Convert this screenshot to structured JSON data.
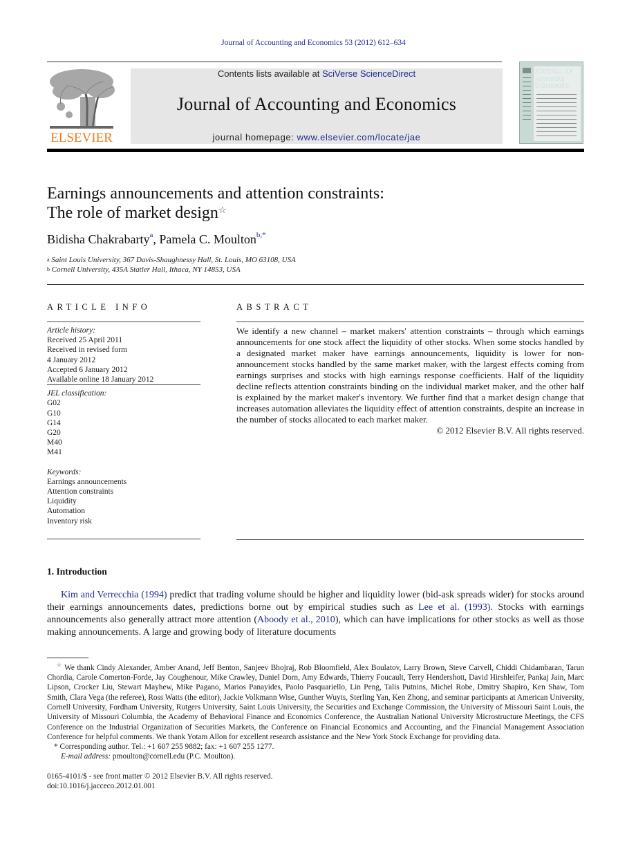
{
  "running_head": "Journal of Accounting and Economics 53 (2012) 612–634",
  "masthead": {
    "publisher_wordmark": "ELSEVIER",
    "contents_prefix": "Contents lists available at ",
    "contents_link": "SciVerse ScienceDirect",
    "journal_title": "Journal of Accounting and Economics",
    "homepage_prefix": "journal homepage: ",
    "homepage_link": "www.elsevier.com/locate/jae",
    "cover_title_lines": [
      "JOURNAL OF",
      "Accounting",
      "& Economics"
    ]
  },
  "article": {
    "title_line1": "Earnings announcements and attention constraints:",
    "title_line2": "The role of market design",
    "title_footnote_mark": "☆",
    "authors": [
      {
        "name": "Bidisha Chakrabarty",
        "marks": "a"
      },
      {
        "name": "Pamela C. Moulton",
        "marks": "b,*"
      }
    ],
    "author_separator": ", ",
    "affiliations": [
      {
        "mark": "a",
        "text": "Saint Louis University, 367 Davis-Shaughnessy Hall, St. Louis, MO 63108, USA"
      },
      {
        "mark": "b",
        "text": "Cornell University, 435A Statler Hall, Ithaca, NY 14853, USA"
      }
    ]
  },
  "article_info": {
    "heading": "ARTICLE INFO",
    "history_label": "Article history:",
    "history": [
      "Received 25 April 2011",
      "Received in revised form",
      "4 January 2012",
      "Accepted 6 January 2012",
      "Available online 18 January 2012"
    ],
    "jel_label": "JEL classification:",
    "jel_codes": [
      "G02",
      "G10",
      "G14",
      "G20",
      "M40",
      "M41"
    ],
    "keywords_label": "Keywords:",
    "keywords": [
      "Earnings announcements",
      "Attention constraints",
      "Liquidity",
      "Automation",
      "Inventory risk"
    ]
  },
  "abstract": {
    "heading": "ABSTRACT",
    "text": "We identify a new channel – market makers' attention constraints – through which earnings announcements for one stock affect the liquidity of other stocks. When some stocks handled by a designated market maker have earnings announcements, liquidity is lower for non-announcement stocks handled by the same market maker, with the largest effects coming from earnings surprises and stocks with high earnings response coefficients. Half of the liquidity decline reflects attention constraints binding on the individual market maker, and the other half is explained by the market maker's inventory. We further find that a market design change that increases automation alleviates the liquidity effect of attention constraints, despite an increase in the number of stocks allocated to each market maker.",
    "copyright": "© 2012 Elsevier B.V. All rights reserved."
  },
  "introduction": {
    "heading": "1.  Introduction",
    "cite1": "Kim and Verrecchia (1994)",
    "text1": " predict that trading volume should be higher and liquidity lower (bid-ask spreads wider) for stocks around their earnings announcements dates, predictions borne out by empirical studies such as ",
    "cite2": "Lee et al. (1993)",
    "text2": ". Stocks with earnings announcements also generally attract more attention (",
    "cite3": "Aboody et al., 2010",
    "text3": "), which can have implications for other stocks as well as those making announcements. A large and growing body of literature documents"
  },
  "footnotes": {
    "ack_mark": "☆",
    "ack_text": " We thank Cindy Alexander, Amber Anand, Jeff Benton, Sanjeev Bhojraj, Rob Bloomfield, Alex Boulatov, Larry Brown, Steve Carvell, Chiddi Chidambaran, Tarun Chordia, Carole Comerton-Forde, Jay Coughenour, Mike Crawley, Daniel Dorn, Amy Edwards, Thierry Foucault, Terry Hendershott, David Hirshleifer, Pankaj Jain, Marc Lipson, Crocker Liu, Stewart Mayhew, Mike Pagano, Marios Panayides, Paolo Pasquariello, Lin Peng, Talis Putnins, Michel Robe, Dmitry Shapiro, Ken Shaw, Tom Smith, Clara Vega (the referee), Ross Watts (the editor), Jackie Volkmann Wise, Gunther Wuyts, Sterling Yan, Ken Zhong, and seminar participants at American University, Cornell University, Fordham University, Rutgers University, Saint Louis University, the Securities and Exchange Commission, the University of Missouri Saint Louis, the University of Missouri Columbia, the Academy of Behavioral Finance and Economics Conference, the Australian National University Microstructure Meetings, the CFS Conference on the Industrial Organization of Securities Markets, the Conference on Financial Economics and Accounting, and the Financial Management Association Conference for helpful comments. We thank Yotam Allon for excellent research assistance and the New York Stock Exchange for providing data.",
    "corresponding": "* Corresponding author. Tel.: +1 607 255 9882; fax: +1 607 255 1277.",
    "email_label": "E-mail address:",
    "email_value": " pmoulton@cornell.edu (P.C. Moulton).",
    "front_matter": "0165-4101/$ - see front matter © 2012 Elsevier B.V. All rights reserved.",
    "doi": "doi:10.1016/j.jacceco.2012.01.001"
  },
  "colors": {
    "link": "#1f2a8f",
    "elsevier_orange": "#f07a1c",
    "masthead_gray": "#e6e6e6",
    "cover_green": "#c9d9d3"
  }
}
